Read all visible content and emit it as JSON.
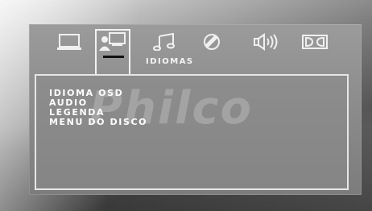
{
  "osd": {
    "tabs": [
      {
        "icon": "monitor-icon",
        "active": false
      },
      {
        "icon": "user-screen-icon",
        "active": true
      },
      {
        "icon": "music-note-icon",
        "active": false
      },
      {
        "icon": "circle-slash-icon",
        "active": false
      },
      {
        "icon": "speaker-icon",
        "active": false
      },
      {
        "icon": "dolby-icon",
        "active": false
      }
    ],
    "section_title": "IDIOMAS",
    "menu_items": [
      {
        "label": "IDIOMA OSD"
      },
      {
        "label": "AUDIO"
      },
      {
        "label": "LEGENDA"
      },
      {
        "label": "MENU DO DISCO"
      }
    ],
    "watermark_text": "Philco"
  }
}
